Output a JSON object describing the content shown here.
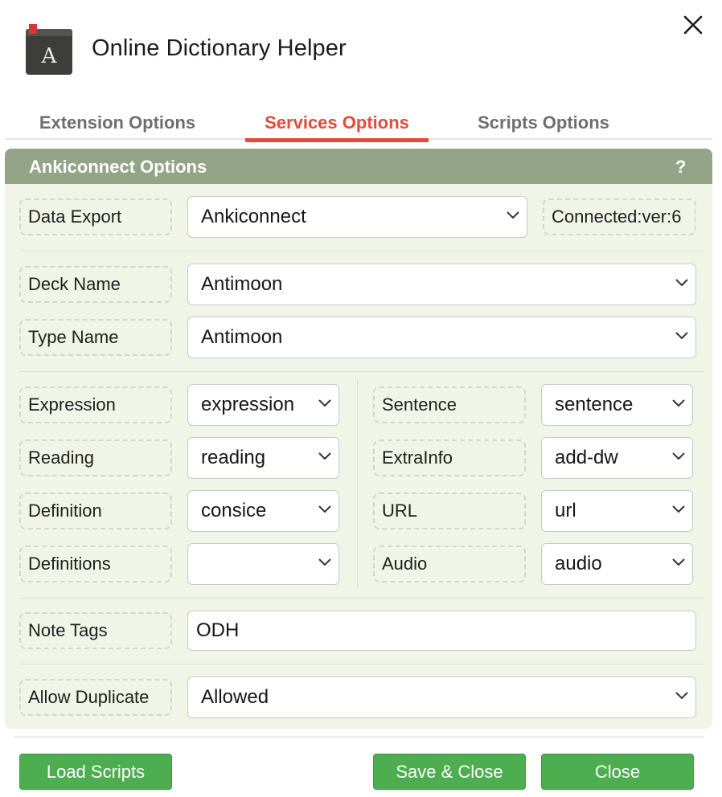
{
  "app": {
    "title": "Online Dictionary Helper",
    "icon": "dictionary-book-icon",
    "icon_letter": "A",
    "close_icon": "close-icon"
  },
  "tabs": [
    {
      "label": "Extension Options",
      "active": false
    },
    {
      "label": "Services Options",
      "active": true
    },
    {
      "label": "Scripts Options",
      "active": false
    }
  ],
  "panel": {
    "title": "Ankiconnect Options",
    "help": "?"
  },
  "data_export": {
    "label": "Data Export",
    "value": "Ankiconnect",
    "status": "Connected:ver:6"
  },
  "deck": {
    "label": "Deck Name",
    "value": "Antimoon"
  },
  "type": {
    "label": "Type Name",
    "value": "Antimoon"
  },
  "fields_left": [
    {
      "label": "Expression",
      "value": "expression"
    },
    {
      "label": "Reading",
      "value": "reading"
    },
    {
      "label": "Definition",
      "value": "consice"
    },
    {
      "label": "Definitions",
      "value": ""
    }
  ],
  "fields_right": [
    {
      "label": "Sentence",
      "value": "sentence"
    },
    {
      "label": "ExtraInfo",
      "value": "add-dw"
    },
    {
      "label": "URL",
      "value": "url"
    },
    {
      "label": "Audio",
      "value": "audio"
    }
  ],
  "note_tags": {
    "label": "Note Tags",
    "value": "ODH"
  },
  "duplicate": {
    "label": "Allow Duplicate",
    "value": "Allowed"
  },
  "buttons": {
    "load_scripts": "Load Scripts",
    "save_close": "Save & Close",
    "close": "Close"
  },
  "colors": {
    "accent_red": "#e14c3a",
    "panel_header": "#93a586",
    "panel_bg": "#f0f5e8",
    "button_green": "#4cae4f"
  }
}
